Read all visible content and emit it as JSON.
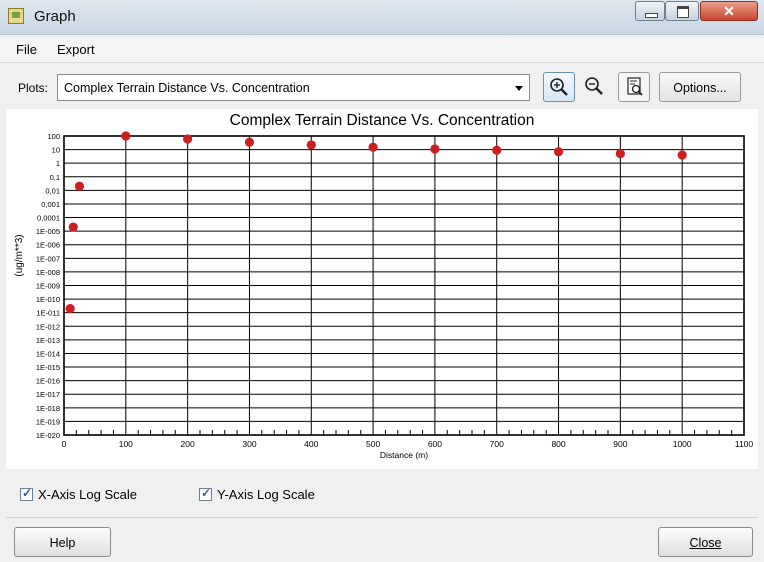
{
  "window": {
    "title": "Graph"
  },
  "menu": {
    "items": [
      "File",
      "Export"
    ]
  },
  "toolbar": {
    "plots_label": "Plots:",
    "plots_selected": "Complex Terrain Distance Vs. Concentration",
    "options_label": "Options..."
  },
  "chart_data": {
    "type": "scatter",
    "title": "Complex Terrain Distance Vs. Concentration",
    "xlabel": "Distance (m)",
    "ylabel": "(ug/m**3)",
    "xlim": [
      0,
      1100
    ],
    "y_log": true,
    "ylim_exponent": [
      -20,
      2
    ],
    "x_ticks": [
      "0",
      "100",
      "200",
      "300",
      "400",
      "500",
      "600",
      "700",
      "800",
      "900",
      "1000",
      "1100"
    ],
    "y_ticks": [
      "1E-020",
      "1E-019",
      "1E-018",
      "1E-017",
      "1E-016",
      "1E-015",
      "1E-014",
      "1E-013",
      "1E-012",
      "1E-011",
      "1E-010",
      "1E-009",
      "1E-008",
      "1E-007",
      "1E-006",
      "1E-005",
      "0,0001",
      "0,001",
      "0,01",
      "0,1",
      "1",
      "10",
      "100"
    ],
    "grid": true,
    "marker_color": "#cc1f1f",
    "points": [
      {
        "x": 10,
        "y": 2e-11
      },
      {
        "x": 15,
        "y": 2e-05
      },
      {
        "x": 25,
        "y": 0.02
      },
      {
        "x": 100,
        "y": 100
      },
      {
        "x": 200,
        "y": 60
      },
      {
        "x": 300,
        "y": 35
      },
      {
        "x": 400,
        "y": 22
      },
      {
        "x": 500,
        "y": 15
      },
      {
        "x": 600,
        "y": 11
      },
      {
        "x": 700,
        "y": 9
      },
      {
        "x": 800,
        "y": 7
      },
      {
        "x": 900,
        "y": 5
      },
      {
        "x": 1000,
        "y": 4
      }
    ]
  },
  "options": {
    "x_log_label": "X-Axis Log Scale",
    "x_log_checked": true,
    "y_log_label": "Y-Axis Log Scale",
    "y_log_checked": true
  },
  "footer": {
    "help_label": "Help",
    "close_label": "Close"
  }
}
